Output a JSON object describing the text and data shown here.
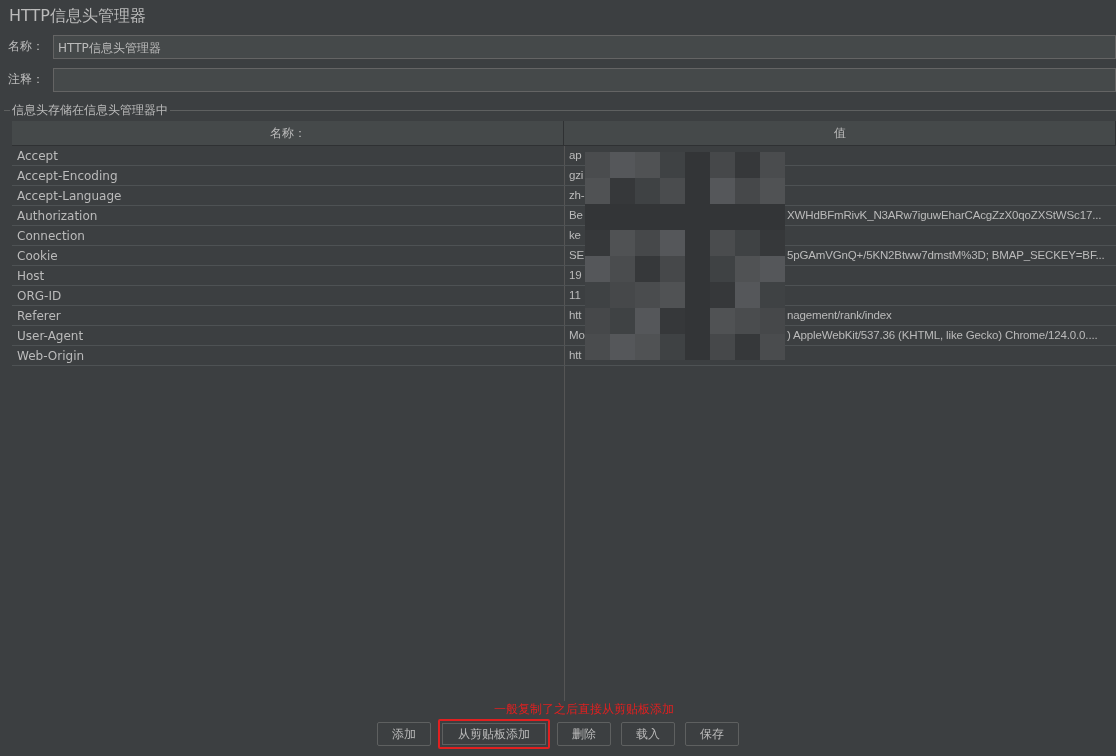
{
  "title": "HTTP信息头管理器",
  "fields": [
    {
      "label": "名称：",
      "value": "HTTP信息头管理器"
    },
    {
      "label": "注释："
    }
  ],
  "group": {
    "title": "信息头存储在信息头管理器中",
    "columns": [
      "名称：",
      "值"
    ],
    "rows": [
      {
        "name": "Accept",
        "value_start": "ap"
      },
      {
        "name": "Accept-Encoding",
        "value_start": "gzi"
      },
      {
        "name": "Accept-Language",
        "value_start": "zh-"
      },
      {
        "name": "Authorization",
        "value_start": "Be",
        "value_end": "XWHdBFmRivK_N3ARw7iguwEharCAcgZzX0qoZXStWSc17..."
      },
      {
        "name": "Connection",
        "value_start": "ke"
      },
      {
        "name": "Cookie",
        "value_start": "SE",
        "value_end": "5pGAmVGnQ+/5KN2Btww7dmstM%3D; BMAP_SECKEY=BF..."
      },
      {
        "name": "Host",
        "value_start": "19"
      },
      {
        "name": "ORG-ID",
        "value_start": "11"
      },
      {
        "name": "Referer",
        "value_start": "htt",
        "value_end": "nagement/rank/index"
      },
      {
        "name": "User-Agent",
        "value_start": "Mo",
        "value_end": ") AppleWebKit/537.36 (KHTML, like Gecko) Chrome/124.0.0...."
      },
      {
        "name": "Web-Origin",
        "value_start": "htt"
      }
    ]
  },
  "annotation": "一般复制了之后直接从剪贴板添加",
  "buttons": [
    {
      "label": "添加",
      "highlighted": false
    },
    {
      "label": "从剪贴板添加",
      "highlighted": true
    },
    {
      "label": "删除",
      "highlighted": false
    },
    {
      "label": "载入",
      "highlighted": false
    },
    {
      "label": "保存",
      "highlighted": false
    }
  ]
}
